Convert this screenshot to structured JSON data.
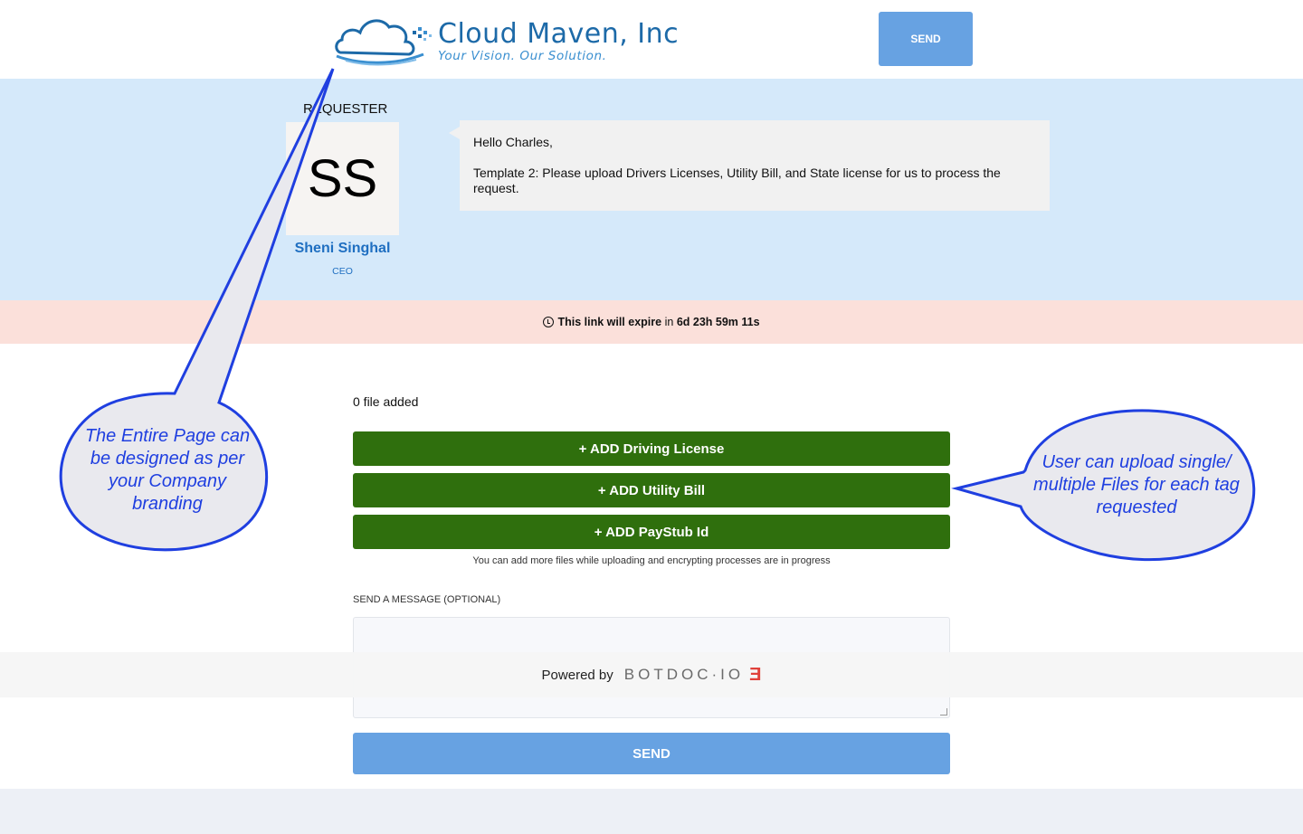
{
  "header": {
    "logo_title": "Cloud Maven, Inc",
    "logo_tagline": "Your Vision. Our Solution.",
    "send_label": "SEND"
  },
  "requester": {
    "label": "REQUESTER",
    "initials": "SS",
    "name": "Sheni Singhal",
    "role": "CEO"
  },
  "message": {
    "greeting": "Hello Charles,",
    "body": "Template 2: Please upload Drivers Licenses, Utility Bill, and State license for us to process the request."
  },
  "expiry": {
    "prefix": "This link will",
    "expire_word": "expire",
    "in_word": "in",
    "countdown": "6d 23h 59m 11s"
  },
  "upload": {
    "file_count": "0 file added",
    "buttons": [
      {
        "label": "+ ADD Driving License"
      },
      {
        "label": "+ ADD Utility Bill"
      },
      {
        "label": "+ ADD PayStub Id"
      }
    ],
    "hint": "You can add more files while uploading and encrypting processes are in progress",
    "message_label": "SEND A MESSAGE (OPTIONAL)",
    "message_value": "",
    "send_label": "SEND"
  },
  "footer": {
    "powered_by": "Powered by",
    "brand": "BOTDOC·IO",
    "brand_mark": "Ǝ"
  },
  "callouts": {
    "left": "The Entire Page can be designed as per your Company branding",
    "right": "User can upload single/ multiple Files for each tag requested"
  },
  "colors": {
    "brand_blue": "#1d6aa8",
    "send_blue": "#67a2e2",
    "add_green": "#2f6f0d",
    "requester_bg": "#d5e9fa",
    "expiry_bg": "#fbe0da",
    "callout_stroke": "#1f3fe0"
  }
}
